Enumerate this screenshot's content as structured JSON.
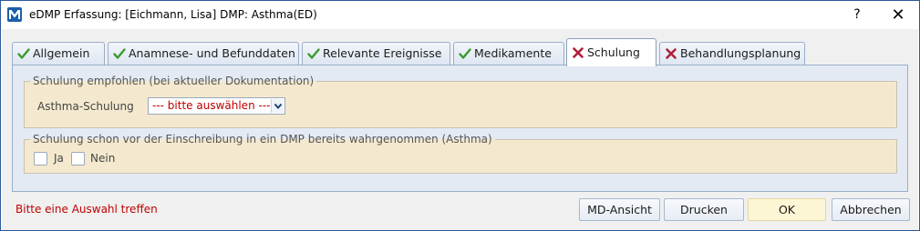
{
  "window": {
    "title": "eDMP Erfassung: [Eichmann, Lisa] DMP: Asthma(ED)",
    "help_label": "?",
    "close_label": "✕"
  },
  "tabs": [
    {
      "label": "Allgemein",
      "status": "check"
    },
    {
      "label": "Anamnese- und Befunddaten",
      "status": "check"
    },
    {
      "label": "Relevante Ereignisse",
      "status": "check"
    },
    {
      "label": "Medikamente",
      "status": "check"
    },
    {
      "label": "Schulung",
      "status": "cross",
      "active": true
    },
    {
      "label": "Behandlungsplanung",
      "status": "cross"
    }
  ],
  "group1": {
    "legend": "Schulung empfohlen (bei aktueller Dokumentation)",
    "field_label": "Asthma-Schulung",
    "select_value": "--- bitte auswählen ---"
  },
  "group2": {
    "legend": "Schulung schon vor der Einschreibung in ein DMP bereits wahrgenommen (Asthma)",
    "option_yes": "Ja",
    "option_no": "Nein"
  },
  "status_message": "Bitte eine Auswahl treffen",
  "buttons": {
    "md_view": "MD-Ansicht",
    "print": "Drucken",
    "ok": "OK",
    "cancel": "Abbrechen"
  },
  "colors": {
    "check": "#3a9a2c",
    "cross": "#b0203a",
    "error_text": "#c00000",
    "group_bg": "#f4e9cf",
    "panel_bg": "#e4eaf3"
  }
}
